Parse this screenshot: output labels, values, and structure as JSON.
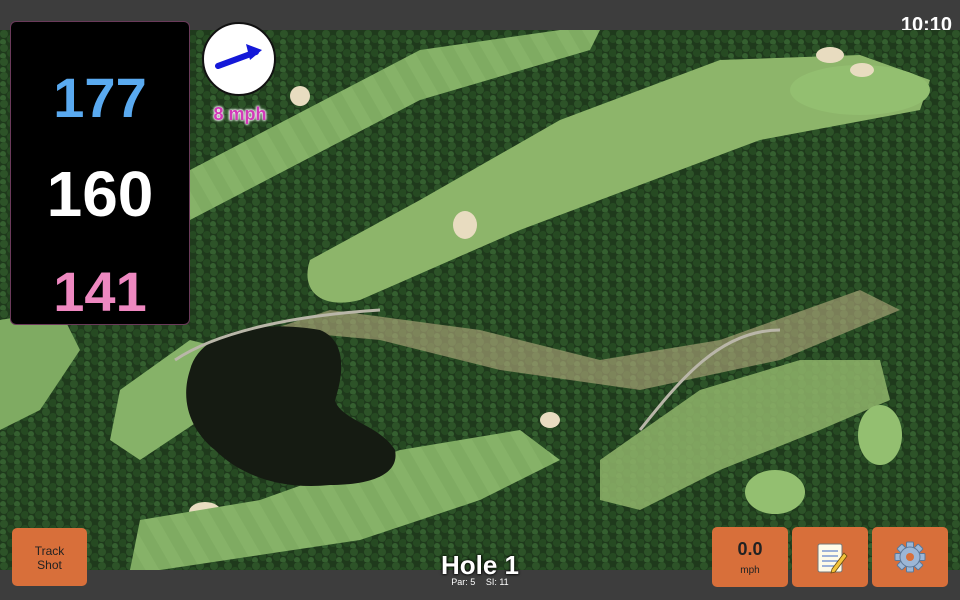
{
  "status": {
    "time": "10:10"
  },
  "yardage": {
    "back": "177",
    "middle": "160",
    "front": "141"
  },
  "wind": {
    "speed_label": "8 mph",
    "direction_icon": "arrow-icon"
  },
  "hole": {
    "title": "Hole 1",
    "par": "Par: 5",
    "si": "SI: 11"
  },
  "buttons": {
    "track_shot_line1": "Track",
    "track_shot_line2": "Shot",
    "wind_value": "0.0",
    "wind_unit": "mph",
    "notes_icon": "notepad-icon",
    "settings_icon": "gear-icon"
  },
  "colors": {
    "back": "#5aaaf0",
    "middle": "#ffffff",
    "front": "#ee88c0",
    "button": "#d86f3a",
    "wind_text": "#d23ab8"
  }
}
